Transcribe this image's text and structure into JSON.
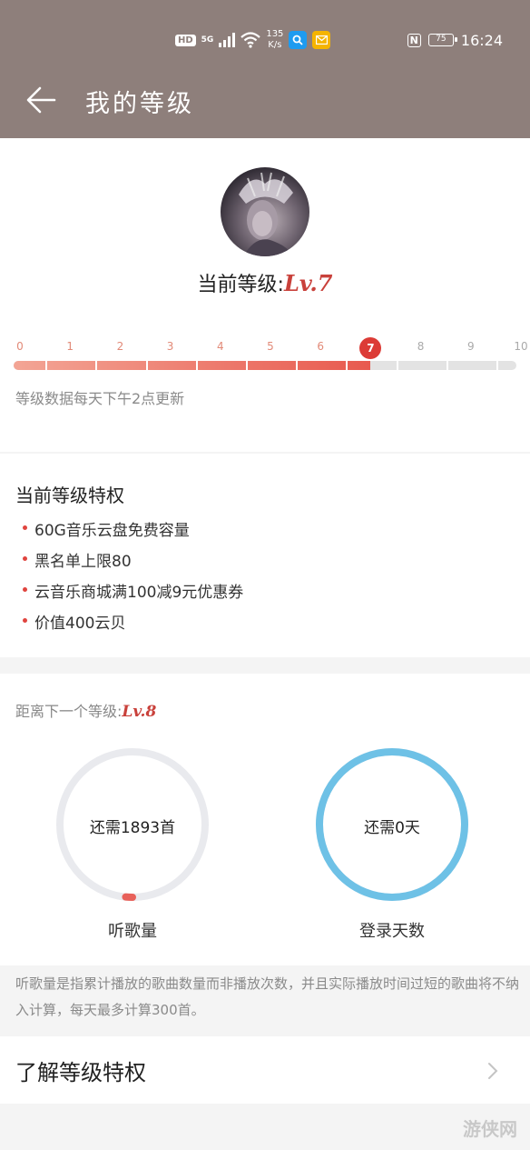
{
  "status_bar": {
    "hd": "HD",
    "network": "5G",
    "speed_value": "135",
    "speed_unit": "K/s",
    "nfc": "N",
    "battery": "75",
    "time": "16:24"
  },
  "header": {
    "title": "我的等级",
    "back_icon": "arrow-left-icon"
  },
  "level": {
    "current_label": "当前等级:",
    "current_value": "Lv.7",
    "ticks": [
      "0",
      "1",
      "2",
      "3",
      "4",
      "5",
      "6",
      "7",
      "8",
      "9",
      "10"
    ],
    "current_index": 7,
    "update_note": "等级数据每天下午2点更新"
  },
  "privileges": {
    "title": "当前等级特权",
    "items": [
      "60G音乐云盘免费容量",
      "黑名单上限80",
      "云音乐商城满100减9元优惠券",
      "价值400云贝"
    ]
  },
  "next": {
    "label": "距离下一个等级:",
    "level": "Lv.8",
    "songs": {
      "text": "还需1893首",
      "caption": "听歌量",
      "progress": 0.03,
      "color": "#e8615a"
    },
    "days": {
      "text": "还需0天",
      "caption": "登录天数",
      "progress": 1.0,
      "color": "#6ec1e6"
    }
  },
  "explain": "听歌量是指累计播放的歌曲数量而非播放次数，并且实际播放时间过短的歌曲将不纳入计算，每天最多计算300首。",
  "learn_more": "了解等级特权",
  "watermark": "游侠网"
}
